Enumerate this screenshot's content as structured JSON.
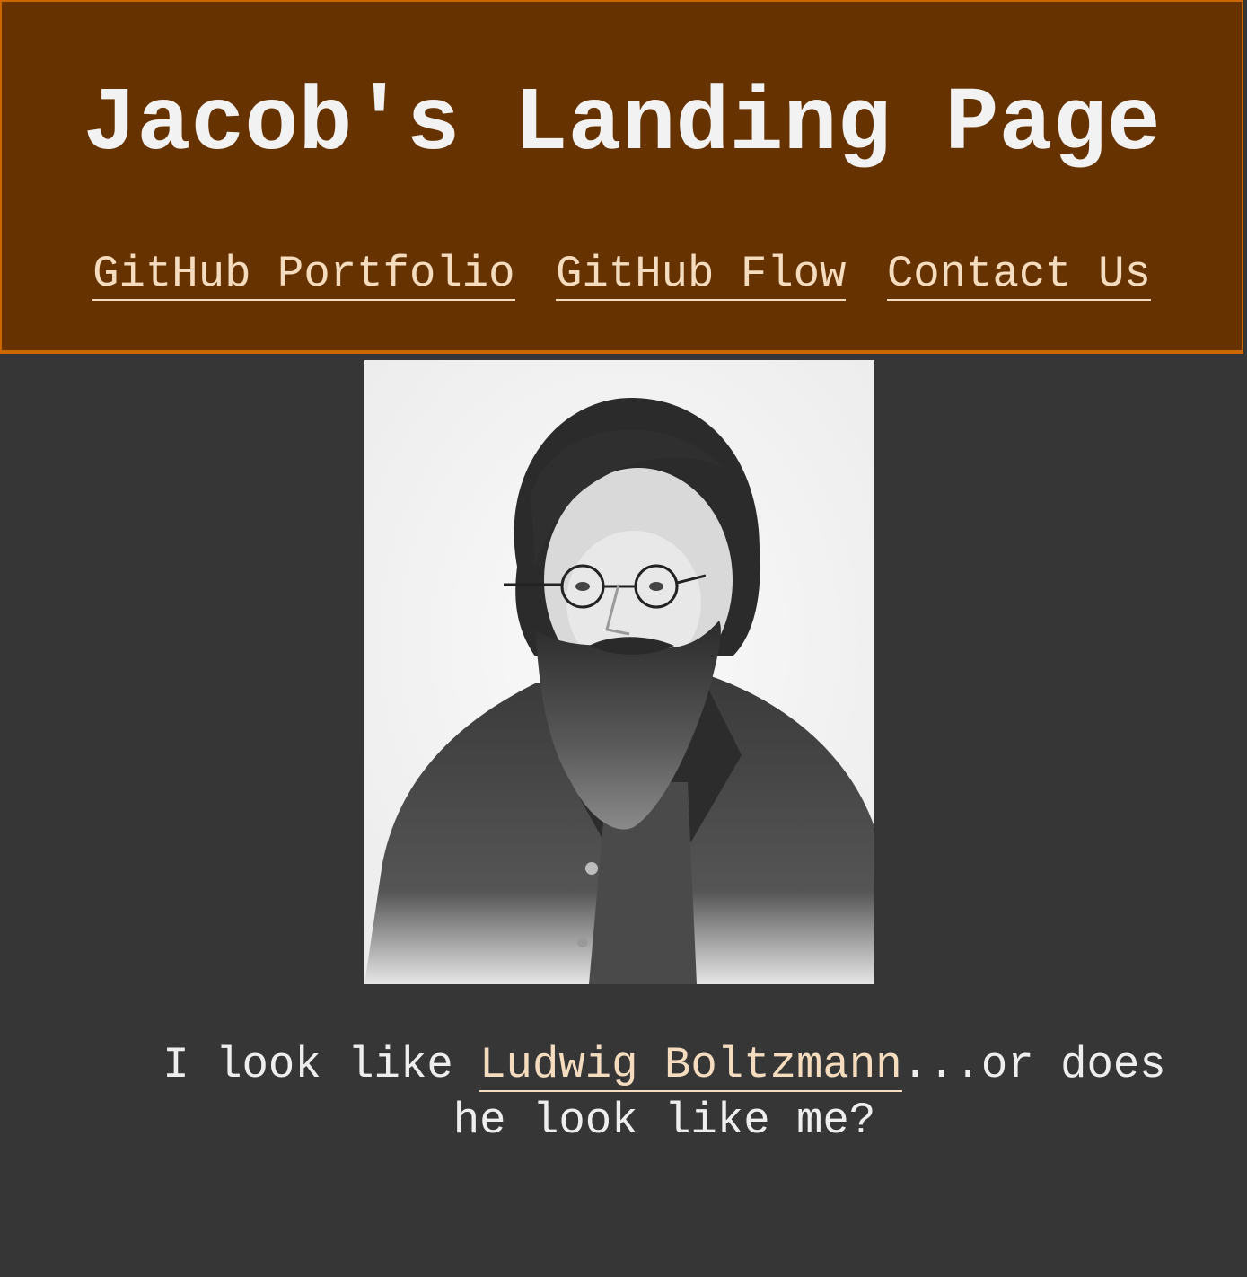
{
  "header": {
    "title": "Jacob's Landing Page",
    "nav": [
      {
        "label": "GitHub Portfolio"
      },
      {
        "label": "GitHub Flow"
      },
      {
        "label": "Contact Us"
      }
    ]
  },
  "main": {
    "portrait_icon": "portrait-photo",
    "caption": {
      "prefix": "I look like ",
      "link": "Ludwig Boltzmann",
      "suffix": "...or does he look like me?"
    }
  },
  "colors": {
    "header_bg": "#663300",
    "header_border": "#cc6600",
    "page_bg": "#363636",
    "link": "#f5dcbf",
    "text": "#eeeeee"
  }
}
